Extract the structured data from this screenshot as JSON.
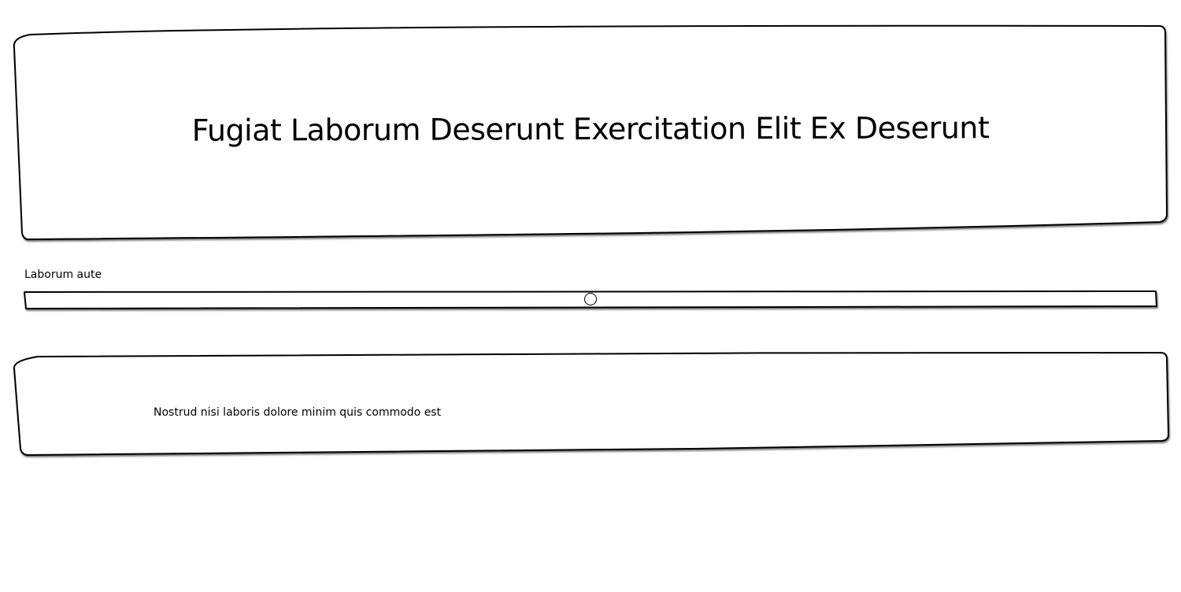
{
  "header": {
    "title": "Fugiat Laborum Deserunt Exercitation Elit Ex Deserunt"
  },
  "slider": {
    "label": "Laborum aute",
    "value": 0.5
  },
  "content": {
    "text": "Nostrud nisi laboris dolore minim quis commodo est"
  }
}
